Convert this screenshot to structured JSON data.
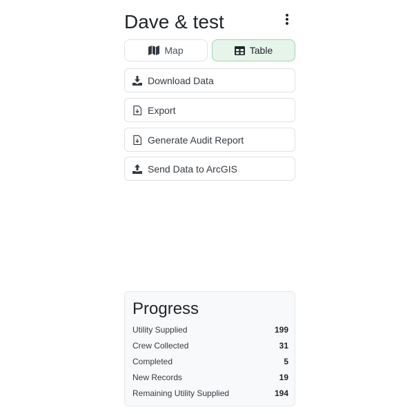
{
  "header": {
    "title": "Dave & test"
  },
  "view_toggle": {
    "map_label": "Map",
    "table_label": "Table",
    "active": "Table"
  },
  "actions": [
    {
      "label": "Download Data",
      "icon": "download-icon"
    },
    {
      "label": "Export",
      "icon": "file-export-icon"
    },
    {
      "label": "Generate Audit Report",
      "icon": "file-report-icon"
    },
    {
      "label": "Send Data to ArcGIS",
      "icon": "upload-icon"
    }
  ],
  "progress": {
    "title": "Progress",
    "rows": [
      {
        "label": "Utility Supplied",
        "value": "199"
      },
      {
        "label": "Crew Collected",
        "value": "31"
      },
      {
        "label": "Completed",
        "value": "5"
      },
      {
        "label": "New Records",
        "value": "19"
      },
      {
        "label": "Remaining Utility Supplied",
        "value": "194"
      }
    ]
  },
  "colors": {
    "active_toggle_bg": "#e6f4ea",
    "active_toggle_border": "#9fd3b0",
    "card_bg": "#f8f9fa",
    "border": "#dee2e6"
  }
}
